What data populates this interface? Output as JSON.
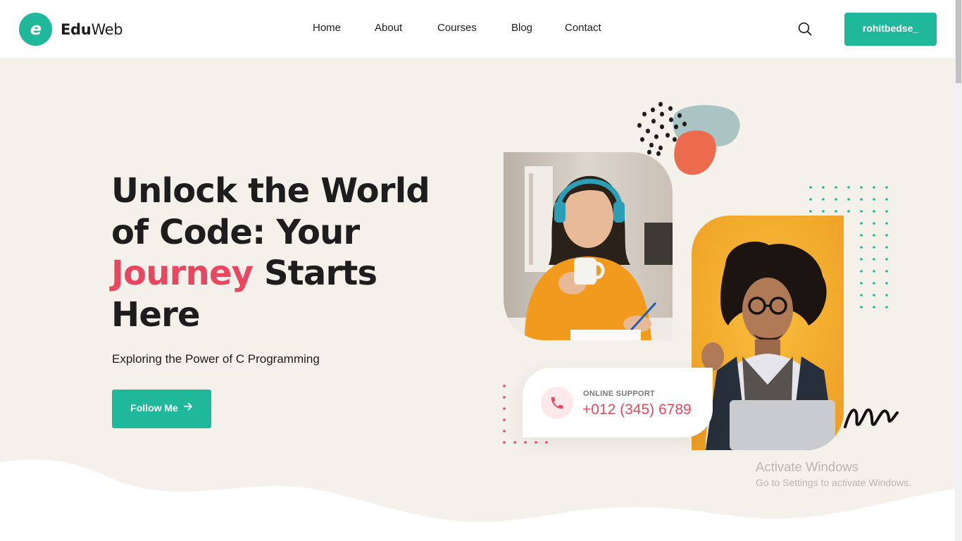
{
  "brand": {
    "name_bold": "Edu",
    "name_light": "Web",
    "logo_icon": "letter-e-logo-icon",
    "color": "#1fb89a"
  },
  "nav": {
    "items": [
      {
        "label": "Home"
      },
      {
        "label": "About"
      },
      {
        "label": "Courses"
      },
      {
        "label": "Blog"
      },
      {
        "label": "Contact"
      }
    ],
    "search_icon": "search-icon",
    "user_button_label": "rohitbedse_"
  },
  "hero": {
    "title_part1": "Unlock the World of Code: Your ",
    "title_accent": "Journey",
    "title_part2": " Starts Here",
    "subtitle": "Exploring the Power of C Programming",
    "cta_label": "Follow Me",
    "cta_icon": "arrow-right-icon"
  },
  "support": {
    "label": "ONLINE SUPPORT",
    "phone": "+012 (345) 6789",
    "icon": "phone-icon"
  },
  "images": {
    "photo1": "woman-with-headphones-writing",
    "photo2": "man-with-glasses-laptop"
  },
  "watermark": {
    "title": "Activate Windows",
    "subtitle": "Go to Settings to activate Windows."
  },
  "colors": {
    "accent_green": "#1fb89a",
    "accent_pink": "#e8475f",
    "hero_bg": "#f4f1ea",
    "photo2_bg": "#f2ad2b",
    "blob_orange": "#ec6a4d",
    "blob_teal": "#a9c4c3"
  }
}
